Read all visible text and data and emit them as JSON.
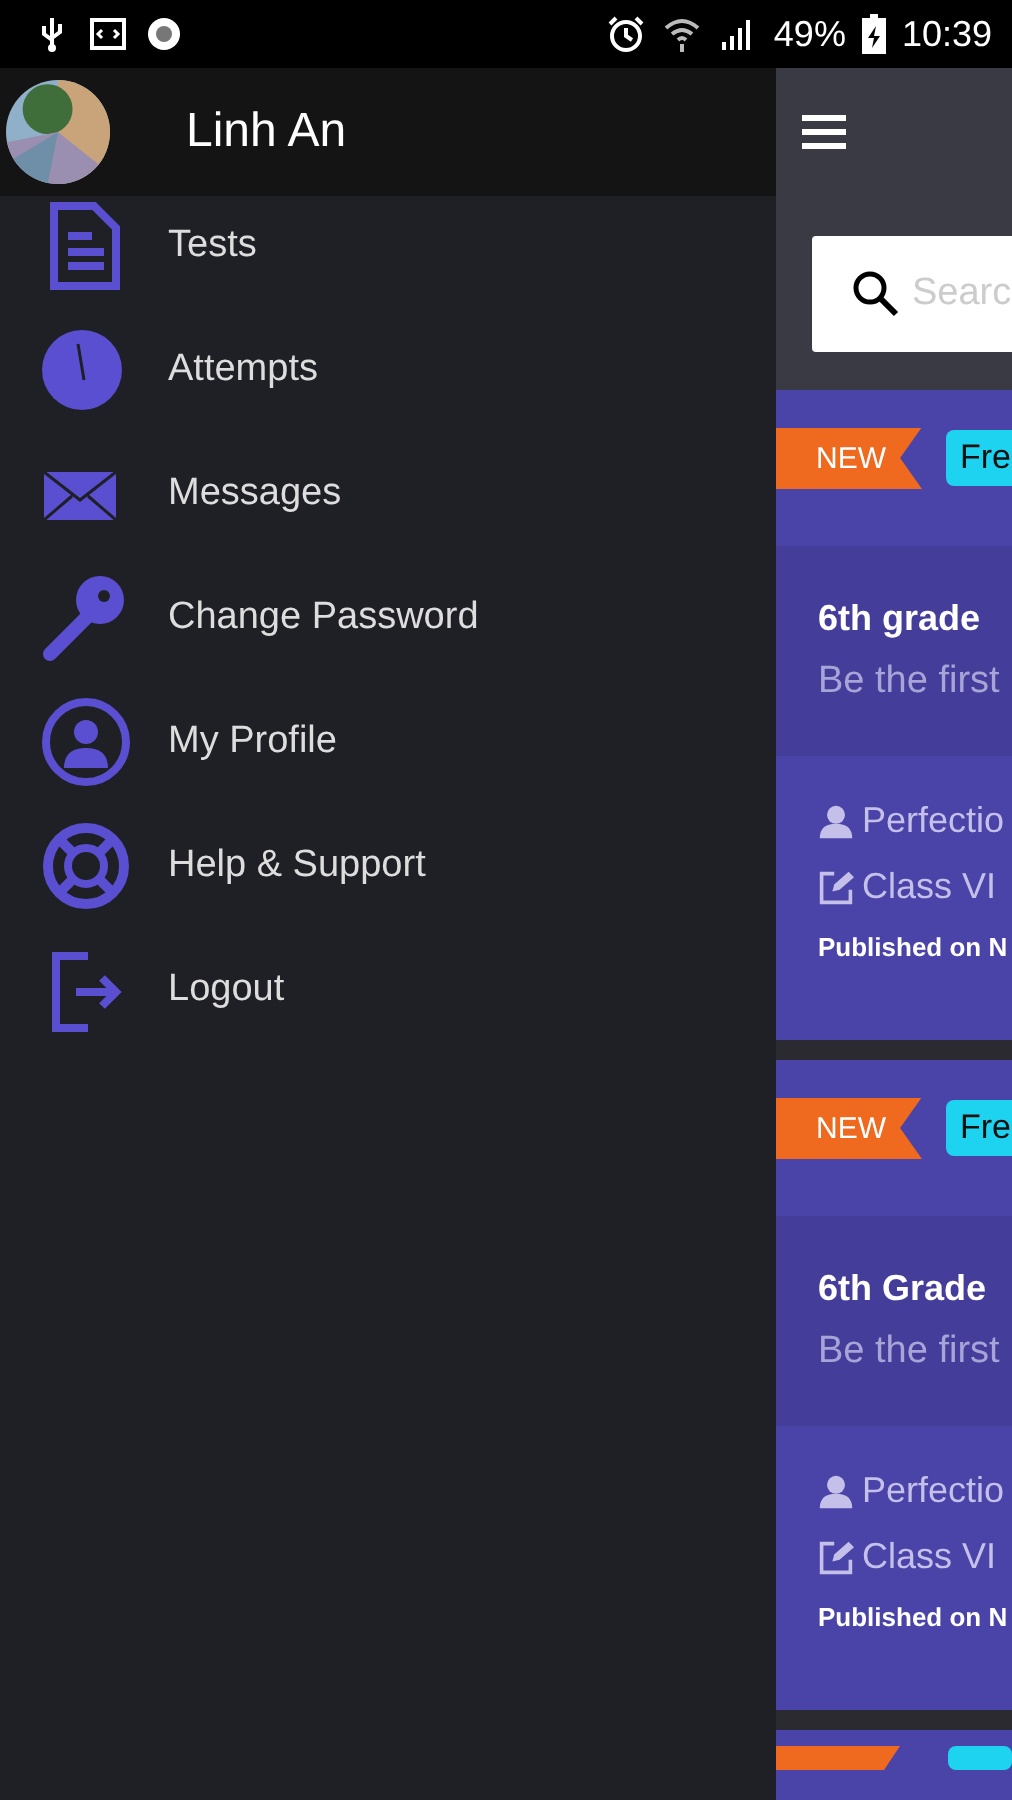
{
  "status_bar": {
    "battery": "49%",
    "time": "10:39"
  },
  "drawer": {
    "user_name": "Linh An",
    "items": [
      {
        "label": "Tests",
        "kind": "document"
      },
      {
        "label": "Attempts",
        "kind": "clock"
      },
      {
        "label": "Messages",
        "kind": "envelope"
      },
      {
        "label": "Change Password",
        "kind": "key"
      },
      {
        "label": "My Profile",
        "kind": "profile"
      },
      {
        "label": "Help & Support",
        "kind": "lifebuoy"
      },
      {
        "label": "Logout",
        "kind": "logout"
      }
    ]
  },
  "main": {
    "search": {
      "placeholder": "Searc"
    },
    "cards": [
      {
        "badges": [
          "NEW",
          "Fre"
        ],
        "title": "6th grade",
        "subtitle": "Be the first",
        "author": "Perfectio",
        "category": "Class VI",
        "published": "Published on N"
      },
      {
        "badges": [
          "NEW",
          "Fre"
        ],
        "title": "6th Grade",
        "subtitle": "Be the first",
        "author": "Perfectio",
        "category": "Class VI",
        "published": "Published on N"
      }
    ]
  }
}
